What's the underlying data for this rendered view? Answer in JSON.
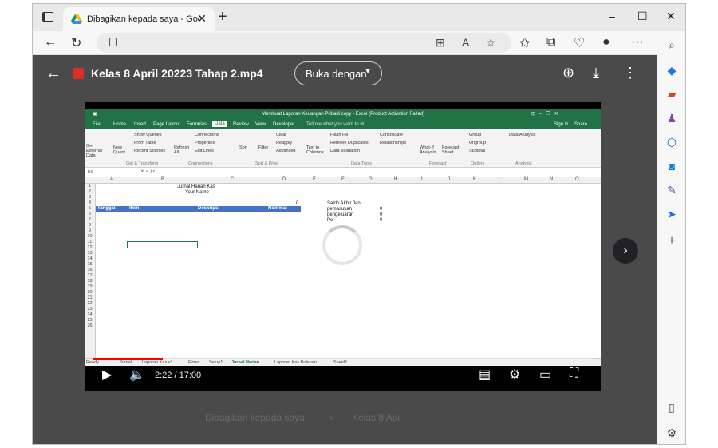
{
  "browser": {
    "tab_title": "Dibagikan kepada saya - Google",
    "tab_close": "✕",
    "new_tab": "+",
    "window_controls": [
      "–",
      "☐",
      "✕"
    ]
  },
  "viewer": {
    "file_title": "Kelas 8 April 20223 Tahap 2.mp4",
    "open_with": "Buka dengan",
    "next": "›",
    "ghost_breadcrumb": "Dibagikan kepada saya",
    "ghost_crumb_sep": "›",
    "ghost_item": "Kelas 8 Api"
  },
  "video": {
    "time": "2:22 / 17:00",
    "progress_fraction": 0.14
  },
  "excel": {
    "title": "Membuat Laporan Keuangan Pribadi copy - Excel (Product Activation Failed)",
    "tabs": [
      "File",
      "Home",
      "Insert",
      "Page Layout",
      "Formulas",
      "Data",
      "Review",
      "View",
      "Developer"
    ],
    "active_tab": "Data",
    "tell_me": "Tell me what you want to do...",
    "signin": "Sign in",
    "share": "Share",
    "ribbon": {
      "get_external": "Get External Data",
      "new_query": "New Query",
      "show_queries": "Show Queries",
      "from_table": "From Table",
      "recent_sources": "Recent Sources",
      "refresh_all": "Refresh All",
      "connections": "Connections",
      "properties": "Properties",
      "edit_links": "Edit Links",
      "sort": "Sort",
      "filter": "Filter",
      "clear": "Clear",
      "reapply": "Reapply",
      "advanced": "Advanced",
      "text_to_columns": "Text to Columns",
      "flash_fill": "Flash Fill",
      "remove_duplicates": "Remove Duplicates",
      "data_validation": "Data Validation",
      "consolidate": "Consolidate",
      "relationships": "Relationships",
      "what_if": "What-If Analysis",
      "forecast_sheet": "Forecast Sheet",
      "group": "Group",
      "ungroup": "Ungroup",
      "subtotal": "Subtotal",
      "data_analysis": "Data Analysis",
      "grp_get_transform": "Get & Transform",
      "grp_connections": "Connections",
      "grp_sort_filter": "Sort & Filter",
      "grp_data_tools": "Data Tools",
      "grp_forecast": "Forecast",
      "grp_outline": "Outline",
      "grp_analysis": "Analysis"
    },
    "name_box": "B9",
    "columns": [
      "A",
      "B",
      "C",
      "D",
      "E",
      "F",
      "G",
      "H",
      "I",
      "J",
      "K",
      "L",
      "M",
      "N",
      "O"
    ],
    "rows": [
      "1",
      "2",
      "3",
      "4",
      "5",
      "6",
      "7",
      "8",
      "9",
      "10",
      "11",
      "12",
      "13",
      "14",
      "15",
      "16",
      "17",
      "18",
      "19",
      "20",
      "21",
      "22",
      "23",
      "24",
      "25",
      "26"
    ],
    "sheet_title": "Jurnal Harian Kas",
    "sheet_name": "Your Name",
    "zero_d3": "0",
    "headers": [
      "Tanggal",
      "Item",
      "Deskripsi",
      "Nominal"
    ],
    "saldo_label": "Saldo Akhir Jan",
    "pemasukan": "pemasukan",
    "pengeluaran": "pengeluaran",
    "pe_partial": "Pe",
    "val_0": "0",
    "sheet_tabs": [
      "Jurnal",
      "Laporan Kas v1",
      "Flows",
      "Setup1",
      "Jurnal Harian",
      "Laporan Kas Bulanan",
      "Sheet1"
    ],
    "active_sheet": "Jurnal Harian",
    "ready": "Ready"
  }
}
